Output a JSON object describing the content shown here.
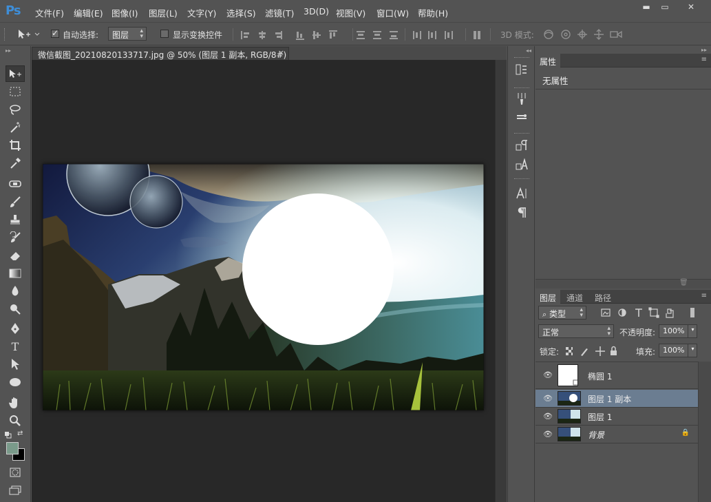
{
  "app": {
    "logo": "Ps"
  },
  "menu": [
    "文件(F)",
    "编辑(E)",
    "图像(I)",
    "图层(L)",
    "文字(Y)",
    "选择(S)",
    "滤镜(T)",
    "3D(D)",
    "视图(V)",
    "窗口(W)",
    "帮助(H)"
  ],
  "window": {
    "minimize": "▬",
    "maximize": "▭",
    "close": "✕"
  },
  "options": {
    "auto_select_label": "自动选择:",
    "auto_select_checked": true,
    "auto_select_target": "图层",
    "show_transform_label": "显示变换控件",
    "mode_3d_label": "3D 模式:"
  },
  "document": {
    "tab_title": "微信截图_20210820133717.jpg @ 50% (图层 1 副本, RGB/8#) *",
    "tab_close": "×"
  },
  "panels": {
    "properties": {
      "tab": "属性",
      "empty_text": "无属性"
    },
    "layers": {
      "tabs": [
        "图层",
        "通道",
        "路径"
      ],
      "filter_kind": "类型",
      "blend_mode": "正常",
      "opacity_label": "不透明度:",
      "opacity_value": "100%",
      "lock_label": "锁定:",
      "fill_label": "填充:",
      "fill_value": "100%",
      "items": [
        {
          "name": "椭圆 1",
          "visible": true,
          "selected": false,
          "locked": false,
          "thumb": "white"
        },
        {
          "name": "图层 1 副本",
          "visible": true,
          "selected": true,
          "locked": false,
          "thumb": "landscape"
        },
        {
          "name": "图层 1",
          "visible": true,
          "selected": false,
          "locked": false,
          "thumb": "landscape"
        },
        {
          "name": "背景",
          "visible": true,
          "selected": false,
          "locked": true,
          "thumb": "landscape"
        }
      ]
    }
  },
  "colors": {
    "foreground": "#7a9a8a",
    "background": "#000000",
    "selection": "#6b7d91",
    "logo": "#3e8ed8"
  }
}
